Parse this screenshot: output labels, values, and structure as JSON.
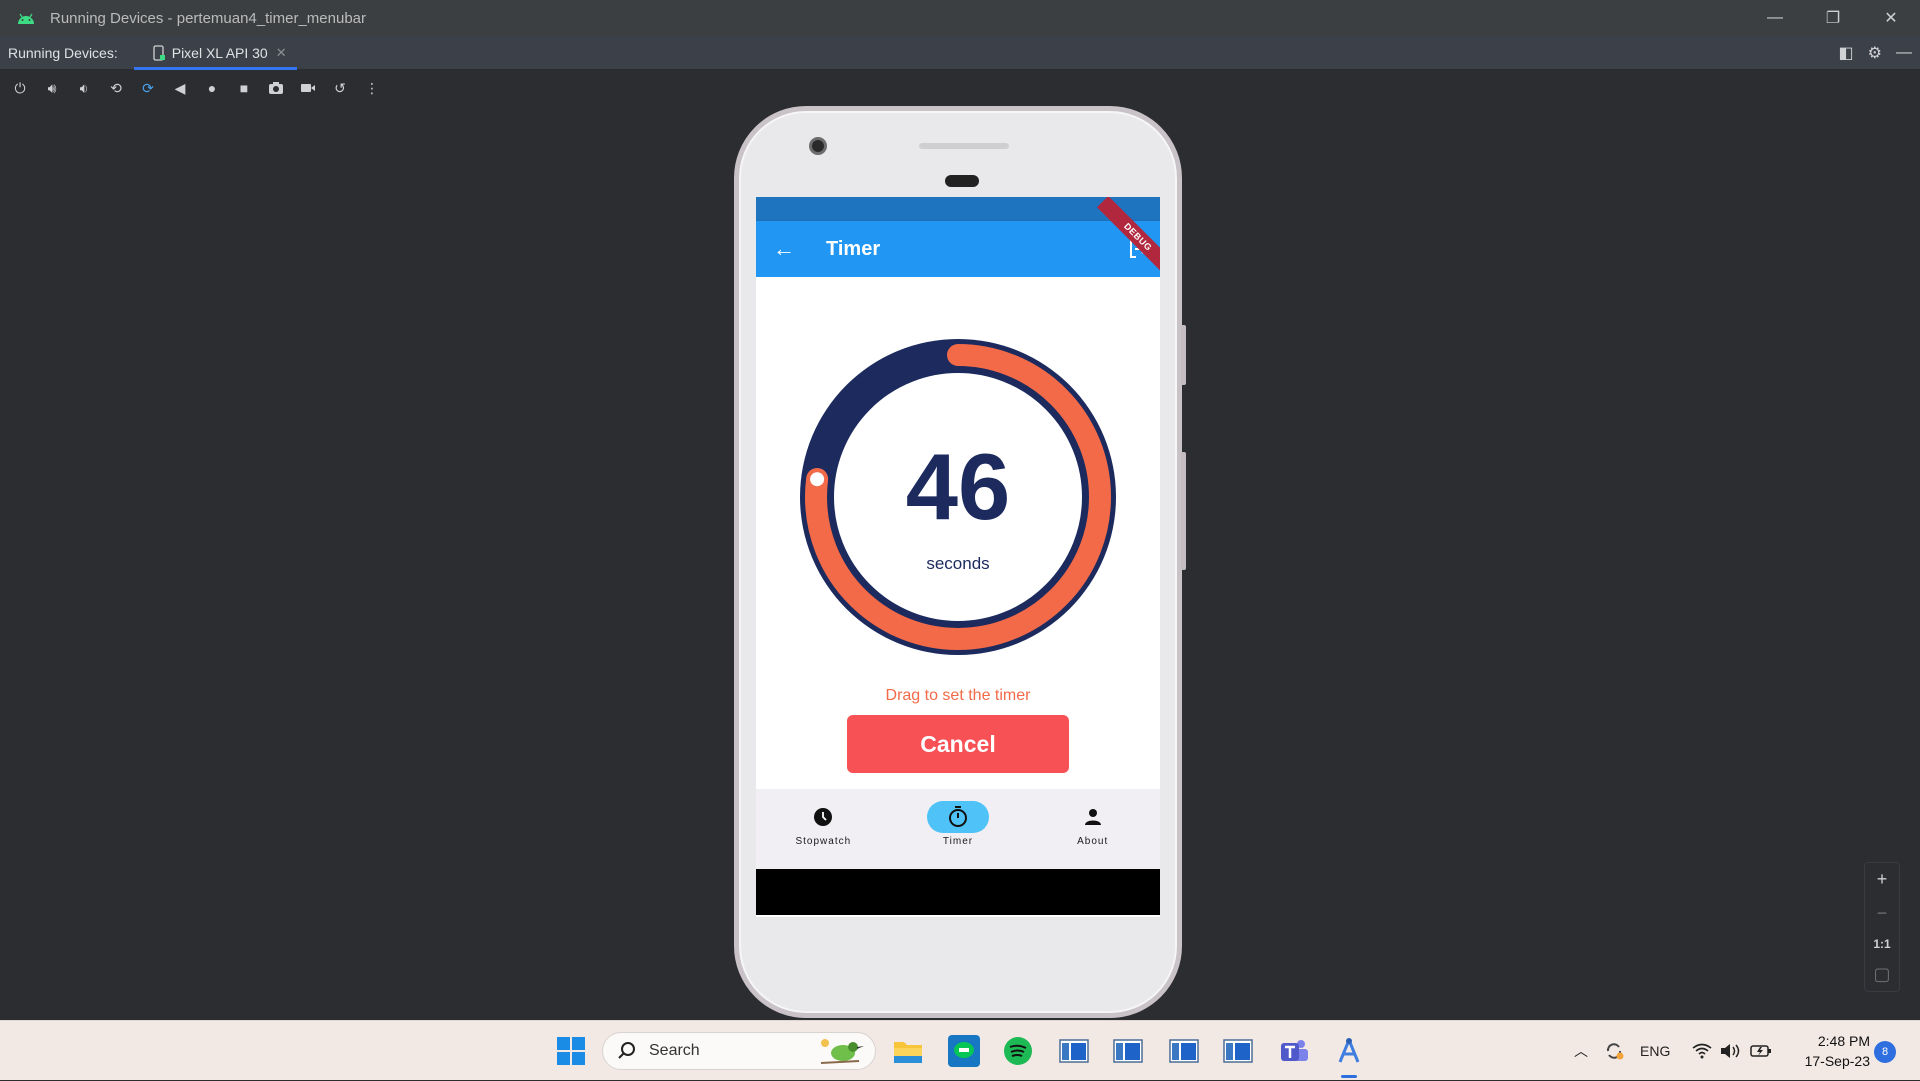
{
  "window": {
    "title": "Running Devices - pertemuan4_timer_menubar",
    "controls": [
      "—",
      "❐",
      "✕"
    ]
  },
  "tabs": {
    "label": "Running Devices:",
    "active_tab": "Pixel XL API 30"
  },
  "app": {
    "title": "Timer",
    "debug_banner": "DEBUG",
    "timer_value": "46",
    "timer_unit": "seconds",
    "progress_fraction": 0.77,
    "hint": "Drag to set the timer",
    "cancel_label": "Cancel",
    "nav": [
      {
        "label": "Stopwatch",
        "icon": "clock-icon",
        "active": false
      },
      {
        "label": "Timer",
        "icon": "timer-icon",
        "active": true
      },
      {
        "label": "About",
        "icon": "person-icon",
        "active": false
      }
    ],
    "colors": {
      "appbar": "#2196f3",
      "ring_track": "#1c2a5e",
      "ring_progress": "#f26a48",
      "cancel": "#f75055",
      "nav_active": "#4fc3f7"
    }
  },
  "zoom": {
    "plus": "+",
    "minus": "−",
    "one_to_one": "1:1"
  },
  "taskbar": {
    "search_placeholder": "Search",
    "tray_language": "ENG",
    "time": "2:48 PM",
    "date": "17-Sep-23",
    "notifications": "8"
  }
}
